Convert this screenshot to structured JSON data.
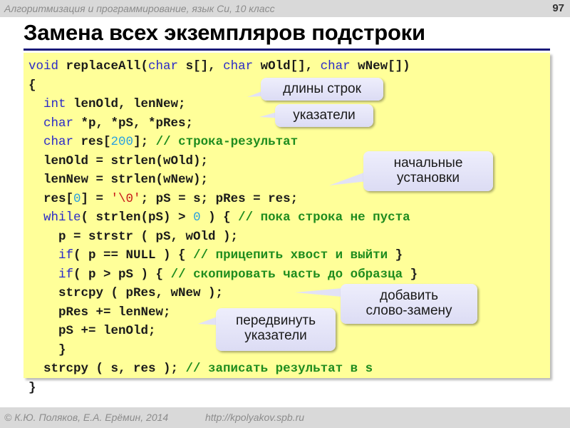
{
  "header": {
    "course_title": "Алгоритмизация и программирование, язык Си, 10 класс",
    "page_number": "97"
  },
  "slide": {
    "title": "Замена всех экземпляров подстроки"
  },
  "code": {
    "lines": [
      [
        {
          "t": "void",
          "c": "kw"
        },
        {
          "t": " replaceAll(",
          "c": ""
        },
        {
          "t": "char",
          "c": "kw"
        },
        {
          "t": " s[], ",
          "c": ""
        },
        {
          "t": "char",
          "c": "kw"
        },
        {
          "t": " wOld[], ",
          "c": ""
        },
        {
          "t": "char",
          "c": "kw"
        },
        {
          "t": " wNew[])",
          "c": ""
        }
      ],
      [
        {
          "t": "{",
          "c": ""
        }
      ],
      [
        {
          "t": "  ",
          "c": ""
        },
        {
          "t": "int",
          "c": "kw"
        },
        {
          "t": " lenOld, lenNew;",
          "c": ""
        }
      ],
      [
        {
          "t": "  ",
          "c": ""
        },
        {
          "t": "char",
          "c": "kw"
        },
        {
          "t": " *p, *pS, *pRes;",
          "c": ""
        }
      ],
      [
        {
          "t": "  ",
          "c": ""
        },
        {
          "t": "char",
          "c": "kw"
        },
        {
          "t": " res[",
          "c": ""
        },
        {
          "t": "200",
          "c": "num"
        },
        {
          "t": "]; ",
          "c": ""
        },
        {
          "t": "// строка-результат",
          "c": "cmt"
        }
      ],
      [
        {
          "t": "  lenOld = strlen(wOld);",
          "c": ""
        }
      ],
      [
        {
          "t": "  lenNew = strlen(wNew);",
          "c": ""
        }
      ],
      [
        {
          "t": "  res[",
          "c": ""
        },
        {
          "t": "0",
          "c": "num"
        },
        {
          "t": "] = ",
          "c": ""
        },
        {
          "t": "'\\0'",
          "c": "str"
        },
        {
          "t": "; pS = s; pRes = res;",
          "c": ""
        }
      ],
      [
        {
          "t": "  ",
          "c": ""
        },
        {
          "t": "while",
          "c": "kw"
        },
        {
          "t": "( strlen(pS) > ",
          "c": ""
        },
        {
          "t": "0",
          "c": "num"
        },
        {
          "t": " ) { ",
          "c": ""
        },
        {
          "t": "// пока строка не пуста",
          "c": "cmt"
        }
      ],
      [
        {
          "t": "    p = strstr ( pS, wOld );",
          "c": ""
        }
      ],
      [
        {
          "t": "    ",
          "c": ""
        },
        {
          "t": "if",
          "c": "kw"
        },
        {
          "t": "( p == NULL ) { ",
          "c": ""
        },
        {
          "t": "// прицепить хвост и выйти",
          "c": "cmt"
        },
        {
          "t": " }",
          "c": ""
        }
      ],
      [
        {
          "t": "    ",
          "c": ""
        },
        {
          "t": "if",
          "c": "kw"
        },
        {
          "t": "( p > pS ) { ",
          "c": ""
        },
        {
          "t": "// скопировать часть до образца",
          "c": "cmt"
        },
        {
          "t": " }",
          "c": ""
        }
      ],
      [
        {
          "t": "    strcpy ( pRes, wNew );",
          "c": ""
        }
      ],
      [
        {
          "t": "    pRes += lenNew;",
          "c": ""
        }
      ],
      [
        {
          "t": "    pS += lenOld;",
          "c": ""
        }
      ],
      [
        {
          "t": "    }",
          "c": ""
        }
      ],
      [
        {
          "t": "  strcpy ( s, res ); ",
          "c": ""
        },
        {
          "t": "// записать результат в s",
          "c": "cmt"
        }
      ],
      [
        {
          "t": "}",
          "c": ""
        }
      ]
    ]
  },
  "callouts": {
    "lengths": "длины строк",
    "pointers": "указатели",
    "init_line1": "начальные",
    "init_line2": "установки",
    "add_line1": "добавить",
    "add_line2": "слово-замену",
    "move_line1": "передвинуть",
    "move_line2": "указатели"
  },
  "footer": {
    "copyright": "© К.Ю. Поляков, Е.А. Ерёмин, 2014",
    "url": "http://kpolyakov.spb.ru"
  },
  "colors": {
    "code_background": "#ffff99",
    "keyword": "#2a2ac8",
    "number": "#28a0e0",
    "string": "#c81818",
    "comment": "#1e8c1e",
    "title_rule": "#1a1a7a",
    "band": "#d9d9d9"
  }
}
